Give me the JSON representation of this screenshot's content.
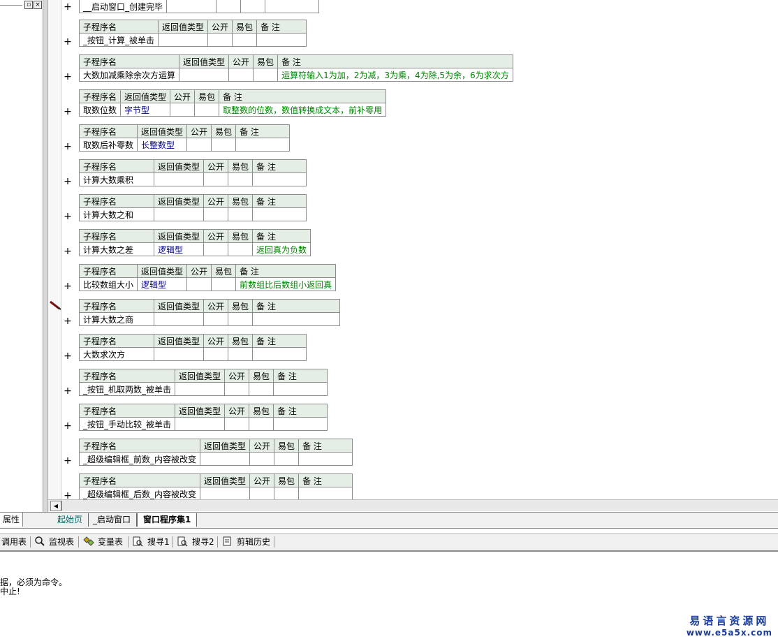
{
  "headers": {
    "name": "子程序名",
    "ret": "返回值类型",
    "pub": "公开",
    "easy": "易包",
    "note": "备 注"
  },
  "first_row": {
    "name": "__启动窗口_创建完毕"
  },
  "plus_symbol": "+",
  "subs": [
    {
      "name": "_按钮_计算_被单击",
      "ret": "",
      "note": ""
    },
    {
      "name": "大数加减乘除余次方运算",
      "ret": "",
      "note": "运算符输入1为加，2为减，3为乘，4为除,5为余，6为求次方"
    },
    {
      "name": "取数位数",
      "ret": "字节型",
      "note": "取整数的位数，数值转换成文本，前补零用"
    },
    {
      "name": "取数后补零数",
      "ret": "长整数型",
      "note": ""
    },
    {
      "name": "计算大数乘积",
      "ret": "",
      "note": ""
    },
    {
      "name": "计算大数之和",
      "ret": "",
      "note": ""
    },
    {
      "name": "计算大数之差",
      "ret": "逻辑型",
      "note": "返回真为负数"
    },
    {
      "name": "比较数组大小",
      "ret": "逻辑型",
      "note": "前数组比后数组小返回真"
    },
    {
      "name": "计算大数之商",
      "ret": "",
      "note": ""
    },
    {
      "name": "大数求次方",
      "ret": "",
      "note": ""
    },
    {
      "name": "_按钮_机取两数_被单击",
      "ret": "",
      "note": ""
    },
    {
      "name": "_按钮_手动比较_被单击",
      "ret": "",
      "note": ""
    },
    {
      "name": "_超级编辑框_前数_内容被改变",
      "ret": "",
      "note": ""
    },
    {
      "name": "_超级编辑框_后数_内容被改变",
      "ret": "",
      "note": ""
    }
  ],
  "tabs": {
    "properties": "属性",
    "start_page": "起始页",
    "startup_window": "_启动窗口",
    "window_program_set": "窗口程序集1"
  },
  "toolbar": {
    "call_table": "调用表",
    "watch_table": "监视表",
    "var_table": "变量表",
    "search1": "搜寻1",
    "search2": "搜寻2",
    "clip_history": "剪辑历史"
  },
  "output": {
    "line1": "据，必须为命令。",
    "line2": "中止!"
  },
  "watermark": {
    "line1": "易语言资源网",
    "line2": "www.e5a5x.com"
  },
  "colors": {
    "header_bg": "#e4eee4",
    "comment": "#008000",
    "type": "#000080"
  }
}
